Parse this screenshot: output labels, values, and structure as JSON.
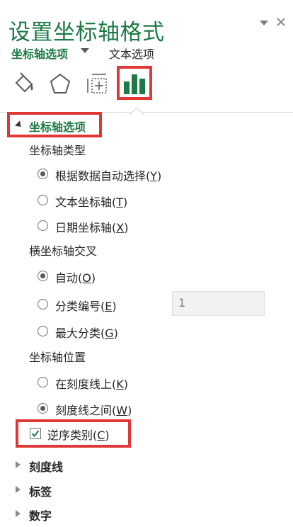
{
  "pane": {
    "title": "设置坐标轴格式",
    "dropdown_icon": "chevron-down-icon",
    "close_icon": "close-icon"
  },
  "tabs": {
    "active_label": "坐标轴选项",
    "other_label": "文本选项"
  },
  "category_icons": [
    "fill-line-icon",
    "effects-pentagon-icon",
    "size-properties-icon",
    "axis-options-barchart-icon"
  ],
  "colors": {
    "accent": "#1d7a45",
    "highlight": "#e13737"
  },
  "section": {
    "title": "坐标轴选项",
    "axis_type": {
      "label": "坐标轴类型",
      "options": [
        {
          "text": "根据数据自动选择(",
          "key": "Y",
          "end": ")",
          "selected": true
        },
        {
          "text": "文本坐标轴(",
          "key": "T",
          "end": ")",
          "selected": false
        },
        {
          "text": "日期坐标轴(",
          "key": "X",
          "end": ")",
          "selected": false
        }
      ]
    },
    "crosses": {
      "label": "横坐标轴交叉",
      "options": [
        {
          "text": "自动(",
          "key": "O",
          "end": ")",
          "selected": true
        },
        {
          "text": "分类编号(",
          "key": "E",
          "end": ")",
          "selected": false
        },
        {
          "text": "最大分类(",
          "key": "G",
          "end": ")",
          "selected": false
        }
      ],
      "category_number_value": "1"
    },
    "position": {
      "label": "坐标轴位置",
      "options": [
        {
          "text": "在刻度线上(",
          "key": "K",
          "end": ")",
          "selected": false
        },
        {
          "text": "刻度线之间(",
          "key": "W",
          "end": ")",
          "selected": true
        }
      ]
    },
    "reverse": {
      "text": "逆序类别(",
      "key": "C",
      "end": ")",
      "checked": true
    }
  },
  "collapsed_sections": [
    "刻度线",
    "标签",
    "数字"
  ]
}
